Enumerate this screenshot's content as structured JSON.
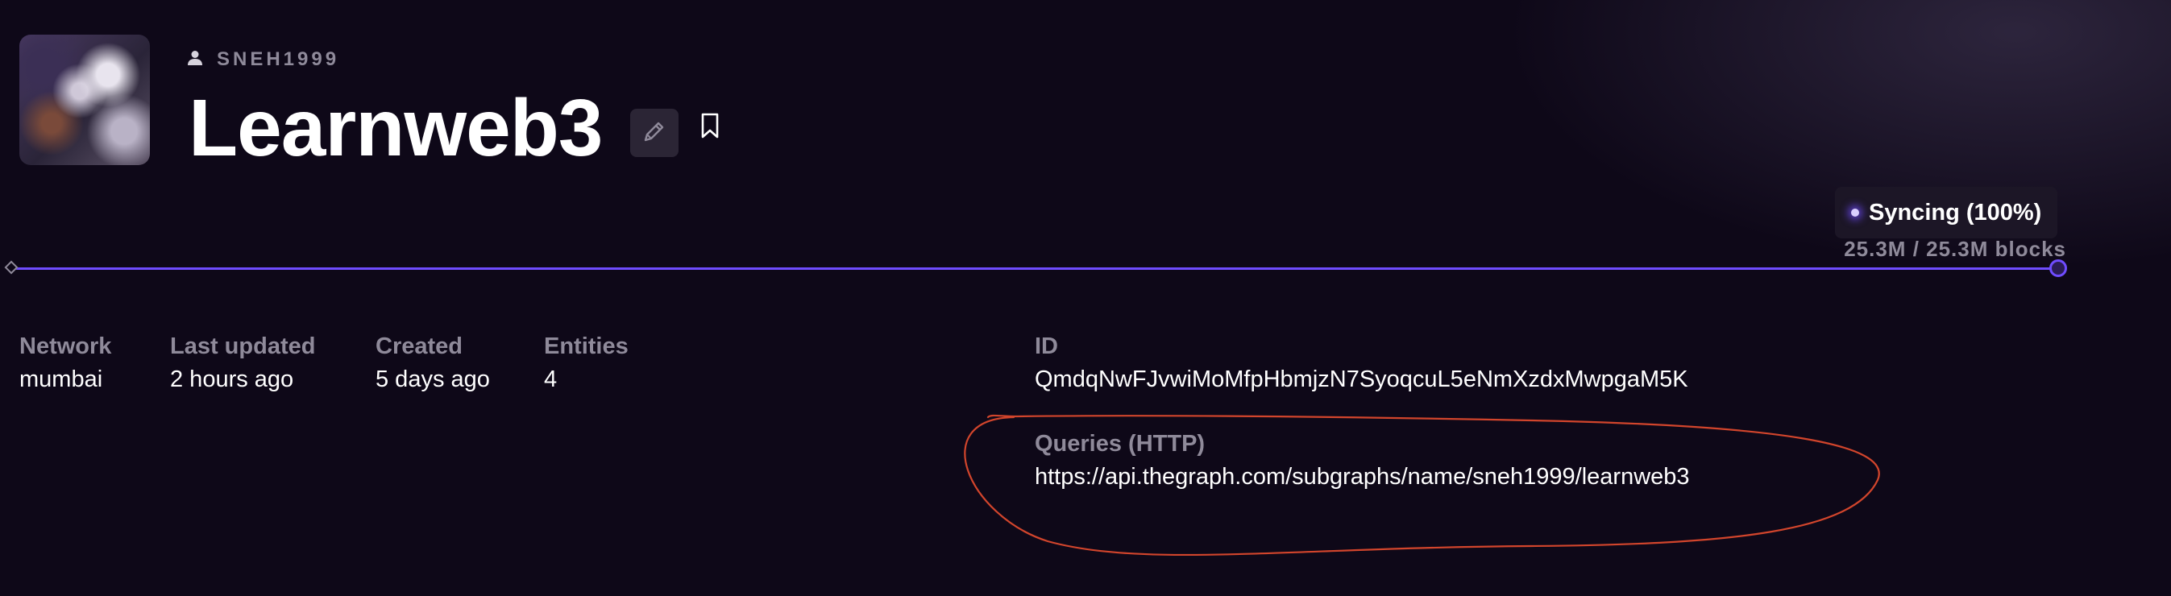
{
  "header": {
    "owner_icon": "user-icon",
    "owner": "SNEH1999",
    "title": "Learnweb3",
    "edit_icon": "pencil-icon",
    "bookmark_icon": "bookmark-icon"
  },
  "sync": {
    "status": "Syncing (100%)",
    "blocks": "25.3M / 25.3M blocks",
    "progress": 1.0,
    "accent_color": "#6f4cff"
  },
  "details": {
    "network": {
      "label": "Network",
      "value": "mumbai"
    },
    "last_updated": {
      "label": "Last updated",
      "value": "2 hours ago"
    },
    "created": {
      "label": "Created",
      "value": "5 days ago"
    },
    "entities": {
      "label": "Entities",
      "value": "4"
    },
    "id": {
      "label": "ID",
      "value": "QmdqNwFJvwiMoMfpHbmjzN7SyoqcuL5eNmXzdxMwpgaM5K"
    },
    "queries": {
      "label": "Queries (HTTP)",
      "value": "https://api.thegraph.com/subgraphs/name/sneh1999/learnweb3"
    }
  },
  "colors": {
    "background": "#0e0818",
    "muted_text": "#8f8a9a",
    "annotation_stroke": "#d2452c"
  }
}
